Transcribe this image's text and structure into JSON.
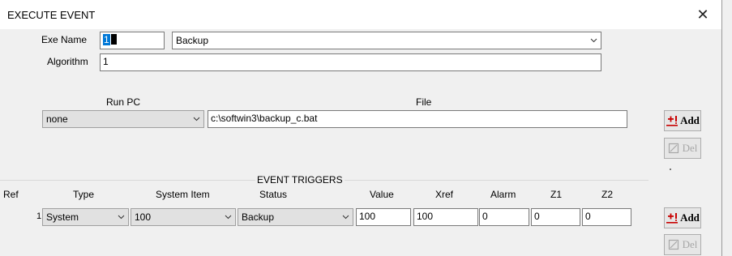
{
  "window": {
    "title": "EXECUTE EVENT",
    "close_label": "✕"
  },
  "form": {
    "exe_name_label": "Exe Name",
    "exe_name_value": "1",
    "exe_name_combo": "Backup",
    "algorithm_label": "Algorithm",
    "algorithm_value": "1",
    "run_pc_label": "Run PC",
    "run_pc_value": "none",
    "file_label": "File",
    "file_value": "c:\\softwin3\\backup_c.bat",
    "add_label": "Add",
    "del_label": "Del"
  },
  "triggers": {
    "section_title": "EVENT TRIGGERS",
    "columns": {
      "ref": "Ref",
      "type": "Type",
      "system_item": "System Item",
      "status": "Status",
      "value": "Value",
      "xref": "Xref",
      "alarm": "Alarm",
      "z1": "Z1",
      "z2": "Z2"
    },
    "rows": [
      {
        "ref": "1",
        "type": "System",
        "system_item": "100",
        "status": "Backup",
        "value": "100",
        "xref": "100",
        "alarm": "0",
        "z1": "0",
        "z2": "0"
      }
    ],
    "add_label": "Add",
    "del_label": "Del"
  },
  "colors": {
    "selection": "#0078d7",
    "add_icon": "#d40000",
    "disabled": "#a7a7a7"
  }
}
